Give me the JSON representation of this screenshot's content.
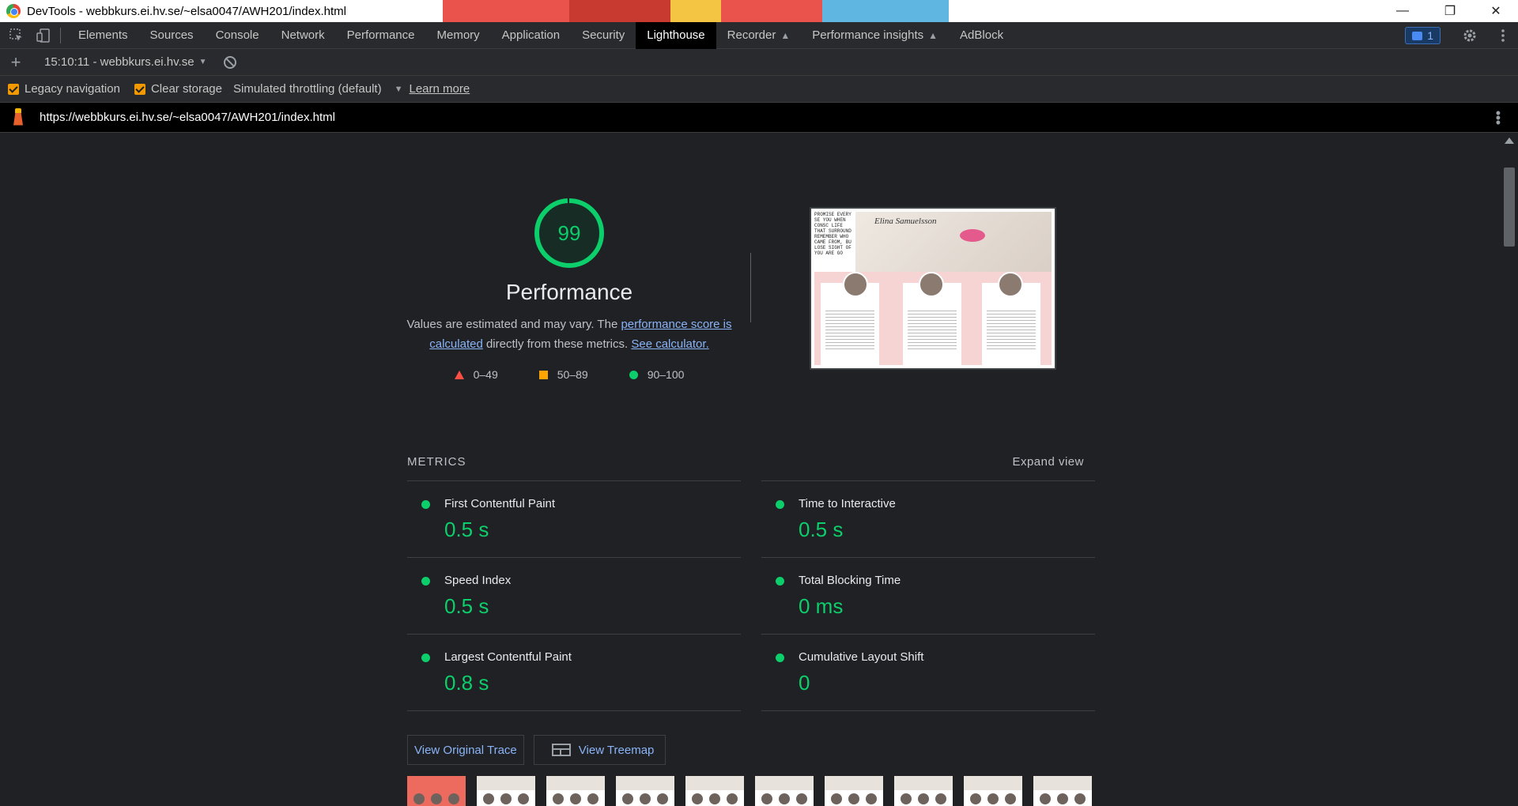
{
  "window": {
    "title": "DevTools - webbkurs.ei.hv.se/~elsa0047/AWH201/index.html",
    "controls": [
      "minimize",
      "restore",
      "close"
    ]
  },
  "devtools": {
    "tabs": [
      {
        "label": "Elements"
      },
      {
        "label": "Sources"
      },
      {
        "label": "Console"
      },
      {
        "label": "Network"
      },
      {
        "label": "Performance"
      },
      {
        "label": "Memory"
      },
      {
        "label": "Application"
      },
      {
        "label": "Security"
      },
      {
        "label": "Lighthouse",
        "active": true
      },
      {
        "label": "Recorder",
        "experimental": true
      },
      {
        "label": "Performance insights",
        "experimental": true
      },
      {
        "label": "AdBlock"
      }
    ],
    "issues_count": "1"
  },
  "lighthouse_toolbar": {
    "report_select": "15:10:11 - webbkurs.ei.hv.se"
  },
  "settings": {
    "legacy_navigation": {
      "label": "Legacy navigation",
      "checked": true
    },
    "clear_storage": {
      "label": "Clear storage",
      "checked": true
    },
    "throttling": "Simulated throttling (default)",
    "learn_more": "Learn more"
  },
  "url_bar": {
    "url": "https://webbkurs.ei.hv.se/~elsa0047/AWH201/index.html"
  },
  "score": {
    "value": "99",
    "fraction": 0.99,
    "title": "Performance",
    "desc_pre": "Values are estimated and may vary. The ",
    "desc_link1": "performance score is calculated",
    "desc_mid": " directly from these metrics. ",
    "desc_link2": "See calculator.",
    "legend": [
      {
        "range": "0–49",
        "shape": "triangle",
        "color": "#ff4e42"
      },
      {
        "range": "50–89",
        "shape": "square",
        "color": "#ffa400"
      },
      {
        "range": "90–100",
        "shape": "circle",
        "color": "#0cce6b"
      }
    ]
  },
  "screenshot": {
    "brand": "Elina Samuelsson",
    "side_text": "PROMISE EVERY SE YOU WHEN CONSC LIFE THAT SURROUND REMEMBER WHO CAME FROM, BU LOSE SIGHT OF YOU ARE GO"
  },
  "metrics": {
    "heading": "METRICS",
    "expand": "Expand view",
    "items": [
      {
        "name": "First Contentful Paint",
        "value": "0.5 s",
        "status": "pass"
      },
      {
        "name": "Time to Interactive",
        "value": "0.5 s",
        "status": "pass"
      },
      {
        "name": "Speed Index",
        "value": "0.5 s",
        "status": "pass"
      },
      {
        "name": "Total Blocking Time",
        "value": "0 ms",
        "status": "pass"
      },
      {
        "name": "Largest Contentful Paint",
        "value": "0.8 s",
        "status": "pass"
      },
      {
        "name": "Cumulative Layout Shift",
        "value": "0",
        "status": "pass"
      }
    ]
  },
  "buttons": {
    "view_trace": "View Original Trace",
    "view_treemap": "View Treemap"
  },
  "colors": {
    "pass": "#0cce6b",
    "average": "#ffa400",
    "fail": "#ff4e42",
    "link": "#8ab4f8",
    "checkbox": "#f29900"
  }
}
